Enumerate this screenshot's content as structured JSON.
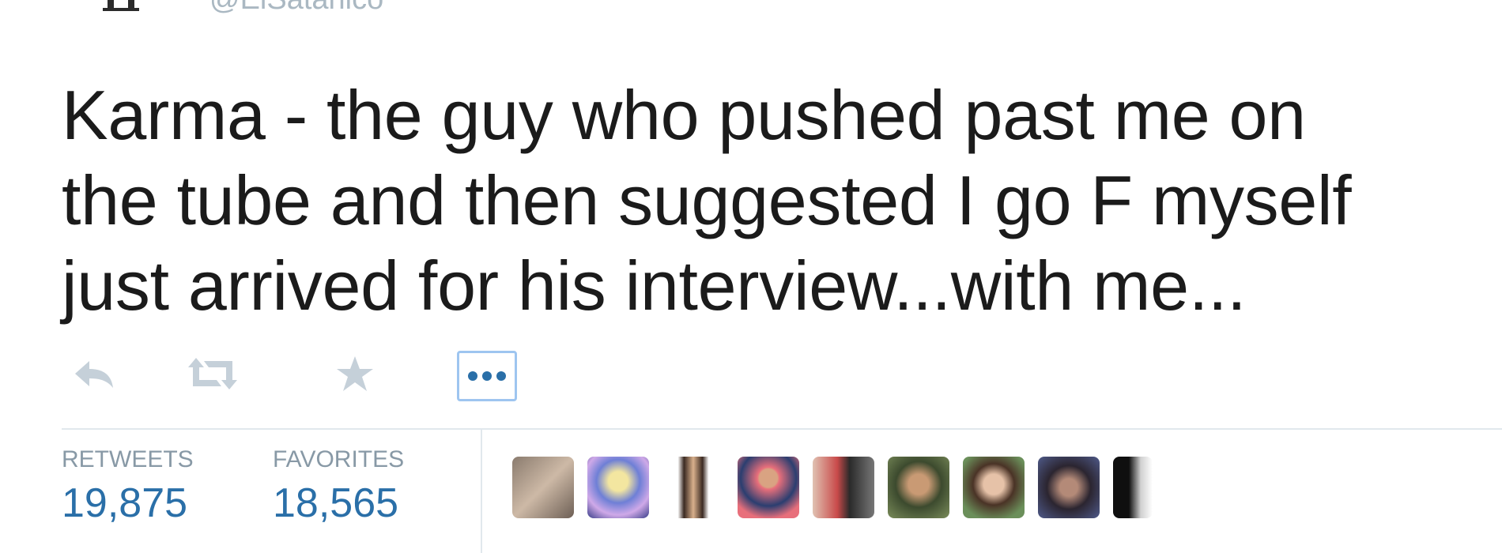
{
  "author": {
    "handle": "@ElSatanico"
  },
  "tweet": {
    "lines": [
      "Karma - the guy who pushed past me on",
      "the tube and then suggested I go F myself",
      "just arrived for his interview...with me..."
    ]
  },
  "actions": {
    "reply": "reply-icon",
    "retweet": "retweet-icon",
    "favorite": "star-icon",
    "more": "more-icon"
  },
  "stats": {
    "retweets_label": "RETWEETS",
    "retweets": "19,875",
    "favorites_label": "FAVORITES",
    "favorites": "18,565"
  },
  "colors": {
    "link": "#2a6fa8",
    "muted": "#8899a6",
    "icon": "#c5d0d9",
    "divider": "#e1e8ed",
    "focus": "#9ec5f0"
  },
  "favoriters": [
    "user-avatar-1",
    "user-avatar-2",
    "user-avatar-3",
    "user-avatar-4",
    "user-avatar-5",
    "user-avatar-6",
    "user-avatar-7",
    "user-avatar-8",
    "user-avatar-9"
  ]
}
